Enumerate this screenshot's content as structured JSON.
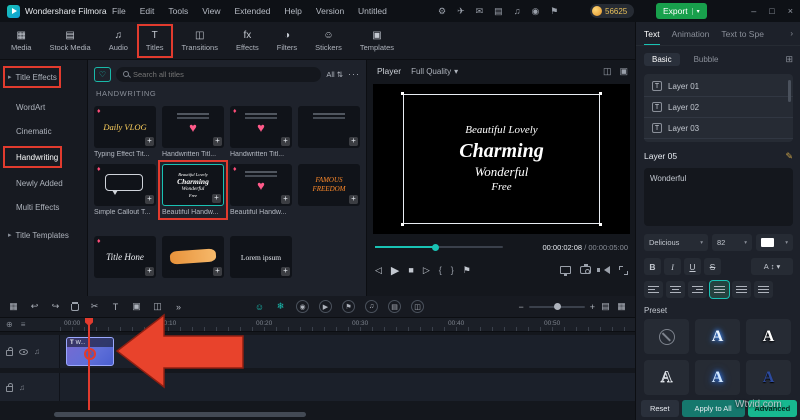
{
  "ui": {
    "chevron_down": "▾",
    "chevron_right": "›",
    "arrow_right": "▸",
    "plus": "+",
    "heart": "♥",
    "diamond": "♦",
    "sort": "⇅",
    "more_dots": "···",
    "minus": "−",
    "cross": "×"
  },
  "titlebar": {
    "app_name": "Wondershare Filmora",
    "menus": [
      "File",
      "Edit",
      "Tools",
      "View",
      "Extended",
      "Help",
      "Version"
    ],
    "project_name": "Untitled",
    "icons": [
      "⚙",
      "✈",
      "✉",
      "▤",
      "♫",
      "◉",
      "⚑"
    ],
    "coins": "56625",
    "export_label": "Export",
    "win_min": "–",
    "win_max": "□",
    "win_close": "×"
  },
  "media_tabs": {
    "items": [
      {
        "label": "Media",
        "icon": "▦"
      },
      {
        "label": "Stock Media",
        "icon": "▤"
      },
      {
        "label": "Audio",
        "icon": "♫"
      },
      {
        "label": "Titles",
        "icon": "T"
      },
      {
        "label": "Transitions",
        "icon": "◫"
      },
      {
        "label": "Effects",
        "icon": "fx"
      },
      {
        "label": "Filters",
        "icon": "◑"
      },
      {
        "label": "Stickers",
        "icon": "☺"
      },
      {
        "label": "Templates",
        "icon": "▣"
      }
    ]
  },
  "sidebar": {
    "items": [
      {
        "label": "Title Effects"
      },
      {
        "label": "WordArt"
      },
      {
        "label": "Cinematic"
      },
      {
        "label": "Handwriting"
      },
      {
        "label": "Newly Added"
      },
      {
        "label": "Multi Effects"
      },
      {
        "label": "Title Templates"
      }
    ]
  },
  "library": {
    "search_placeholder": "Search all titles",
    "filter_all": "All",
    "section_header": "HANDWRITING",
    "items": [
      {
        "label": "Typing Effect Tit...",
        "text": "Daily VLOG"
      },
      {
        "label": "Handwritten Titl...",
        "text": ""
      },
      {
        "label": "Handwritten Titl...",
        "text": ""
      },
      {
        "label": "",
        "text": ""
      },
      {
        "label": "Simple Callout T...",
        "text": ""
      },
      {
        "label": "Beautiful Handw...",
        "text": ""
      },
      {
        "label": "Beautiful Handw...",
        "text": ""
      },
      {
        "label": "",
        "text": "FAMOUS FREEDOM"
      },
      {
        "label": "",
        "text": "Title Hone"
      },
      {
        "label": "",
        "text": ""
      },
      {
        "label": "",
        "text": "Lorem ipsum"
      }
    ]
  },
  "player": {
    "label": "Player",
    "quality": "Full Quality",
    "preview_lines": [
      "Beautiful Lovely",
      "Charming",
      "Wonderful",
      "Free"
    ],
    "current_time": "00:00:02:08",
    "time_separator": " / ",
    "total_time": "00:00:05:00",
    "icons": {
      "prev": "◁",
      "play": "▶",
      "stop": "■",
      "next": "▷",
      "brace_open": "{",
      "brace_close": "}",
      "flag": "⚑"
    }
  },
  "properties": {
    "tabs": [
      "Text",
      "Animation",
      "Text to Spe"
    ],
    "subtabs": [
      "Basic",
      "Bubble"
    ],
    "layers": [
      "Layer 01",
      "Layer 02",
      "Layer 03"
    ],
    "layer_icon": "T",
    "active_layer": "Layer 05",
    "edit_icon": "✎",
    "text_value": "Wonderful",
    "font": "Delicious",
    "font_size": "82",
    "style_buttons": [
      "B",
      "I",
      "U",
      "S"
    ],
    "spacing_letter": "A",
    "spacing_arrow": "↕",
    "preset_label": "Preset",
    "preset_letter": "A",
    "reset_label": "Reset",
    "apply_label": "Apply to All",
    "advanced_label": "Advanced"
  },
  "timeline": {
    "toolbar_left": [
      "▦",
      "↩",
      "↪",
      "✂",
      "T",
      "▣",
      "◫",
      "»"
    ],
    "toolbar_teal": [
      "☺",
      "❄"
    ],
    "toolbar_circles": [
      "◉",
      "▶",
      "⚑",
      "♫",
      "▤",
      "◫"
    ],
    "toolbar_right": [
      "▤",
      "▦"
    ],
    "ruler_labels": [
      "00:00",
      "00:10",
      "00:20",
      "00:30",
      "00:40",
      "00:50"
    ],
    "ruler_corner": [
      "⊕",
      "≡"
    ],
    "clip_badge": "T",
    "clip_title": "W..."
  },
  "watermark": "Wtvid.com"
}
